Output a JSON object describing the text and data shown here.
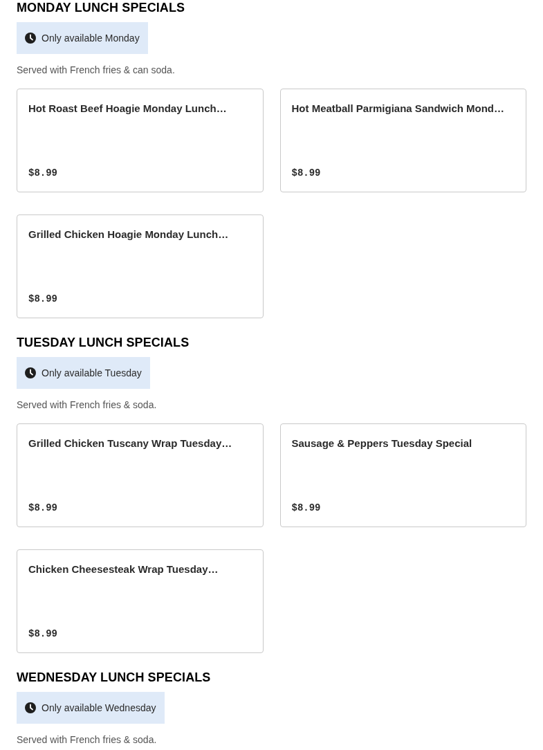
{
  "sections": [
    {
      "heading": "MONDAY LUNCH SPECIALS",
      "availability": "Only available Monday",
      "description": "Served with French fries & can soda.",
      "items": [
        {
          "name": "Hot Roast Beef Hoagie Monday Lunch…",
          "price": "$8.99"
        },
        {
          "name": "Hot Meatball Parmigiana Sandwich Mond…",
          "price": "$8.99"
        },
        {
          "name": "Grilled Chicken Hoagie Monday Lunch…",
          "price": "$8.99"
        }
      ]
    },
    {
      "heading": "TUESDAY LUNCH SPECIALS",
      "availability": "Only available Tuesday",
      "description": "Served with French fries & soda.",
      "items": [
        {
          "name": "Grilled Chicken Tuscany Wrap Tuesday…",
          "price": "$8.99"
        },
        {
          "name": "Sausage & Peppers Tuesday Special",
          "price": "$8.99"
        },
        {
          "name": "Chicken Cheesesteak Wrap Tuesday…",
          "price": "$8.99"
        }
      ]
    },
    {
      "heading": "WEDNESDAY LUNCH SPECIALS",
      "availability": "Only available Wednesday",
      "description": "Served with French fries & soda."
    }
  ]
}
